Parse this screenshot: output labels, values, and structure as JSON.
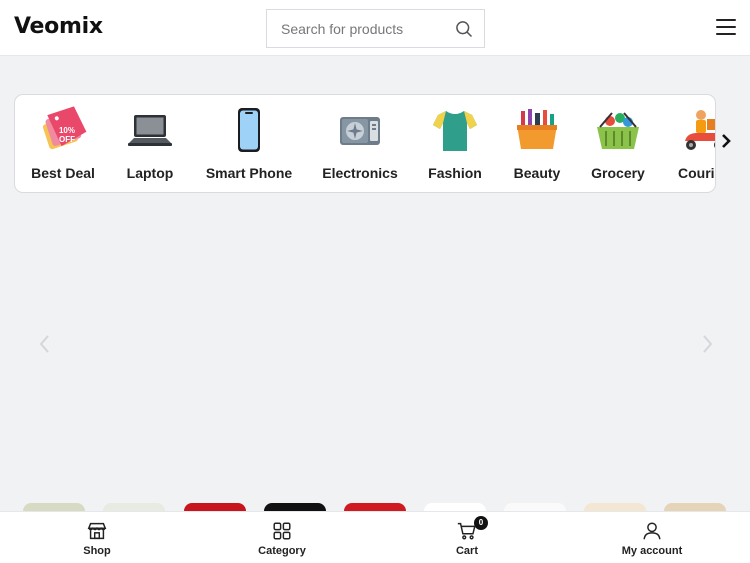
{
  "header": {
    "logo": "Veomix",
    "search_placeholder": "Search for products"
  },
  "categories": [
    {
      "label": "Best Deal",
      "icon": "discount-tag-icon",
      "tag_line1": "10%",
      "tag_line2": "OFF"
    },
    {
      "label": "Laptop",
      "icon": "laptop-icon"
    },
    {
      "label": "Smart Phone",
      "icon": "smartphone-icon"
    },
    {
      "label": "Electronics",
      "icon": "air-conditioner-icon"
    },
    {
      "label": "Fashion",
      "icon": "tshirt-icon"
    },
    {
      "label": "Beauty",
      "icon": "cosmetics-bag-icon"
    },
    {
      "label": "Grocery",
      "icon": "grocery-basket-icon"
    },
    {
      "label": "Courier",
      "icon": "delivery-scooter-icon"
    }
  ],
  "colors": {
    "background": "#f1f2f4",
    "surface": "#ffffff",
    "border": "#d9dbe0",
    "text": "#222222"
  },
  "bottom_nav": {
    "shop": "Shop",
    "category": "Category",
    "cart": "Cart",
    "cart_count": "0",
    "account": "My account"
  }
}
